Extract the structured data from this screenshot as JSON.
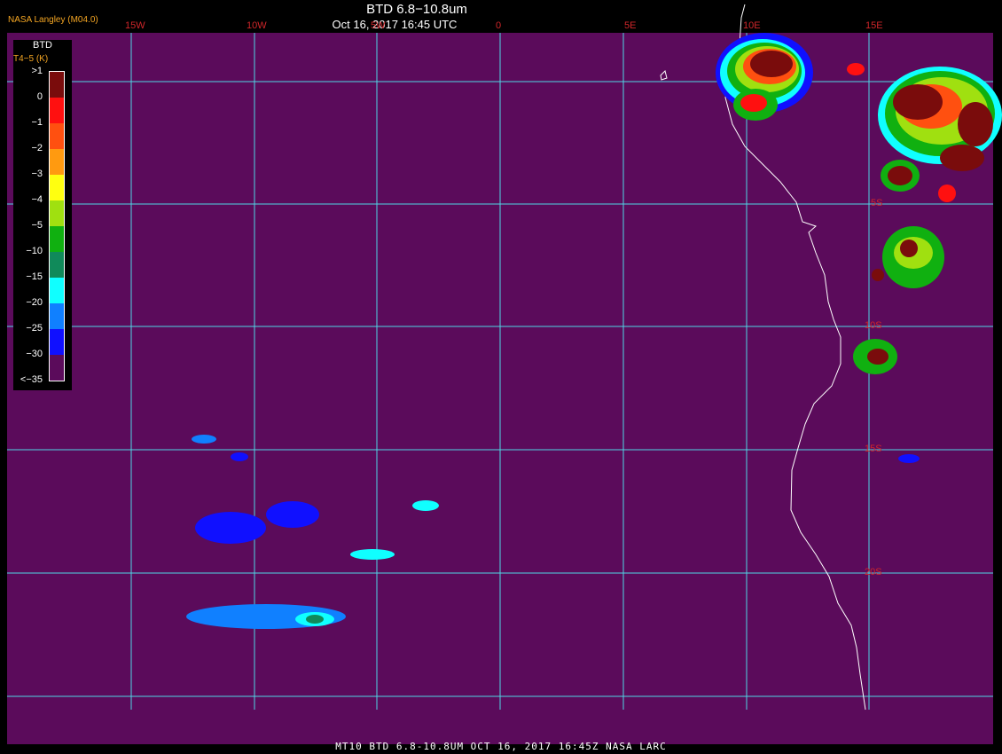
{
  "header": {
    "credit": "NASA Langley (M04.0)",
    "title": "BTD 6.8−10.8um",
    "subtitle": "Oct 16, 2017 16:45 UTC"
  },
  "legend": {
    "title": "BTD",
    "unit": "T4−5 (K)",
    "levels": [
      {
        "label": ">1",
        "color": "#7a0c0c"
      },
      {
        "label": "0",
        "color": "#ff1010"
      },
      {
        "label": "−1",
        "color": "#ff5010"
      },
      {
        "label": "−2",
        "color": "#ff9a10"
      },
      {
        "label": "−3",
        "color": "#ffff10"
      },
      {
        "label": "−4",
        "color": "#a0e010"
      },
      {
        "label": "−5",
        "color": "#10b010"
      },
      {
        "label": "−10",
        "color": "#108a5a"
      },
      {
        "label": "−15",
        "color": "#10ffff"
      },
      {
        "label": "−20",
        "color": "#1080ff"
      },
      {
        "label": "−25",
        "color": "#1010ff"
      },
      {
        "label": "−30",
        "color": "#5b0b5b"
      },
      {
        "label": "<−35",
        "color": "#5b0b5b"
      }
    ]
  },
  "grid": {
    "lon_labels": [
      "15W",
      "10W",
      "5W",
      "0",
      "5E",
      "10E",
      "15E"
    ],
    "lat_labels": [
      "5S",
      "10S",
      "15S",
      "20S"
    ]
  },
  "footer": "MT10  BTD 6.8-10.8UM   OCT 16, 2017 16:45Z   NASA LARC",
  "colors": {
    "background": "#5b0b5b",
    "grid": "#4fd7e6",
    "coast": "#ffffff",
    "label": "#d0262a"
  }
}
